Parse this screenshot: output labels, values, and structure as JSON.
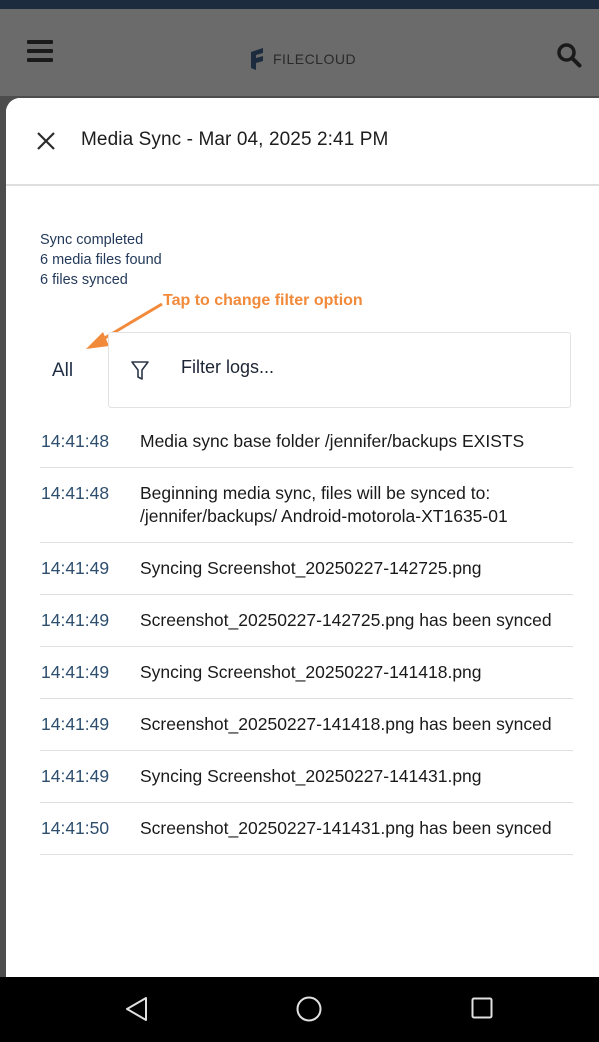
{
  "app": {
    "logo_text": "FILECLOUD",
    "brand_color": "#1c2b3d"
  },
  "sheet": {
    "title": "Media Sync - Mar 04, 2025 2:41 PM"
  },
  "summary": {
    "status": "Sync completed",
    "found": "6 media files found",
    "synced": "6 files synced"
  },
  "annotation": {
    "text": "Tap to change filter option",
    "color": "#f28a3c"
  },
  "filter": {
    "option_label": "All",
    "placeholder": "Filter logs..."
  },
  "logs": [
    {
      "time": "14:41:48",
      "message": "Media sync base folder /jennifer/backups EXISTS"
    },
    {
      "time": "14:41:48",
      "message": "Beginning media sync, files will be synced to: /jennifer/backups/ Android-motorola-XT1635-01"
    },
    {
      "time": "14:41:49",
      "message": "Syncing Screenshot_20250227-142725.png"
    },
    {
      "time": "14:41:49",
      "message": "Screenshot_20250227-142725.png has been synced"
    },
    {
      "time": "14:41:49",
      "message": "Syncing Screenshot_20250227-141418.png"
    },
    {
      "time": "14:41:49",
      "message": "Screenshot_20250227-141418.png has been synced"
    },
    {
      "time": "14:41:49",
      "message": "Syncing Screenshot_20250227-141431.png"
    },
    {
      "time": "14:41:50",
      "message": "Screenshot_20250227-141431.png has been synced"
    }
  ],
  "icons": {
    "menu": "hamburger-menu-icon",
    "search": "search-icon",
    "close": "close-icon",
    "filter": "filter-icon",
    "nav_back": "triangle-back-icon",
    "nav_home": "circle-home-icon",
    "nav_recent": "square-recents-icon"
  }
}
